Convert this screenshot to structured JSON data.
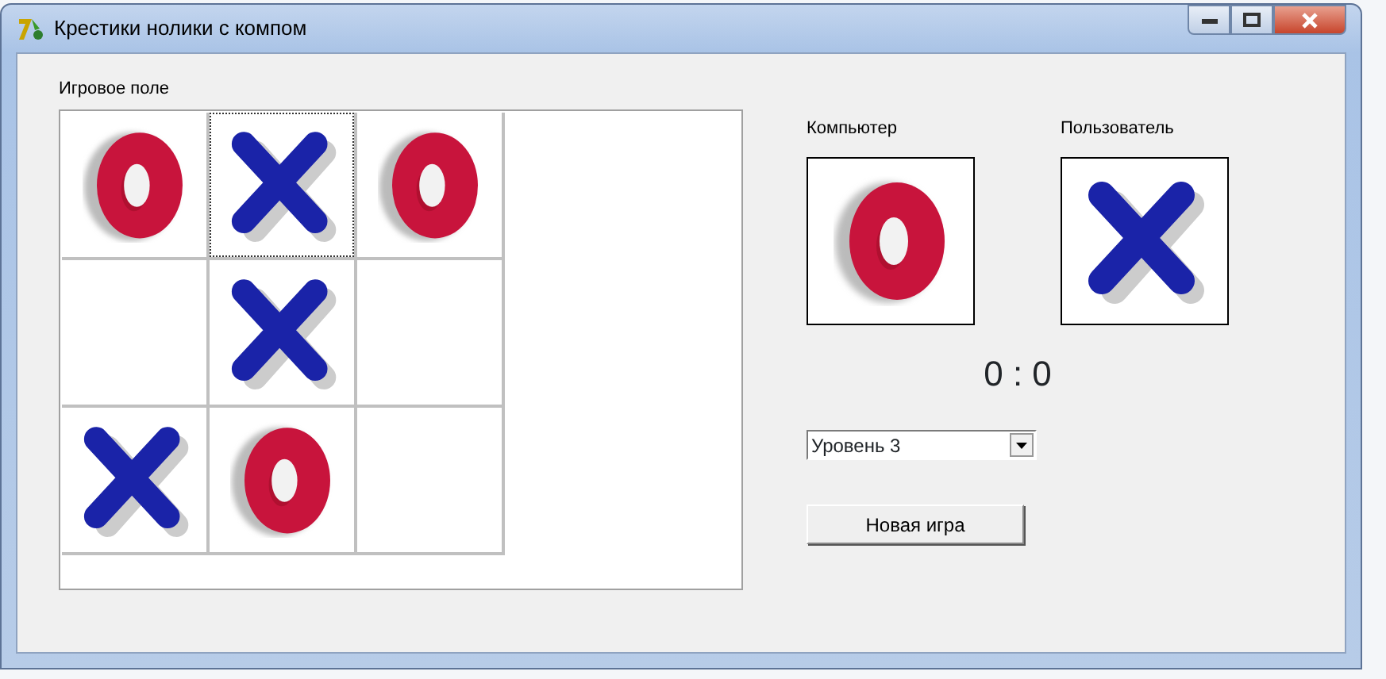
{
  "window": {
    "title": "Крестики нолики с компом"
  },
  "board": {
    "label": "Игровое поле",
    "cells": [
      {
        "kind": "o",
        "focused": false
      },
      {
        "kind": "x",
        "focused": true
      },
      {
        "kind": "o",
        "focused": false
      },
      {
        "kind": "empty",
        "focused": false
      },
      {
        "kind": "x",
        "focused": false
      },
      {
        "kind": "empty",
        "focused": false
      },
      {
        "kind": "x",
        "focused": false
      },
      {
        "kind": "o",
        "focused": false
      },
      {
        "kind": "empty",
        "focused": false
      }
    ]
  },
  "players": [
    {
      "label": "Компьютер",
      "kind": "o"
    },
    {
      "label": "Пользователь",
      "kind": "x"
    }
  ],
  "score": "0 : 0",
  "level_select": {
    "value": "Уровень 3"
  },
  "new_game_button": "Новая игра"
}
